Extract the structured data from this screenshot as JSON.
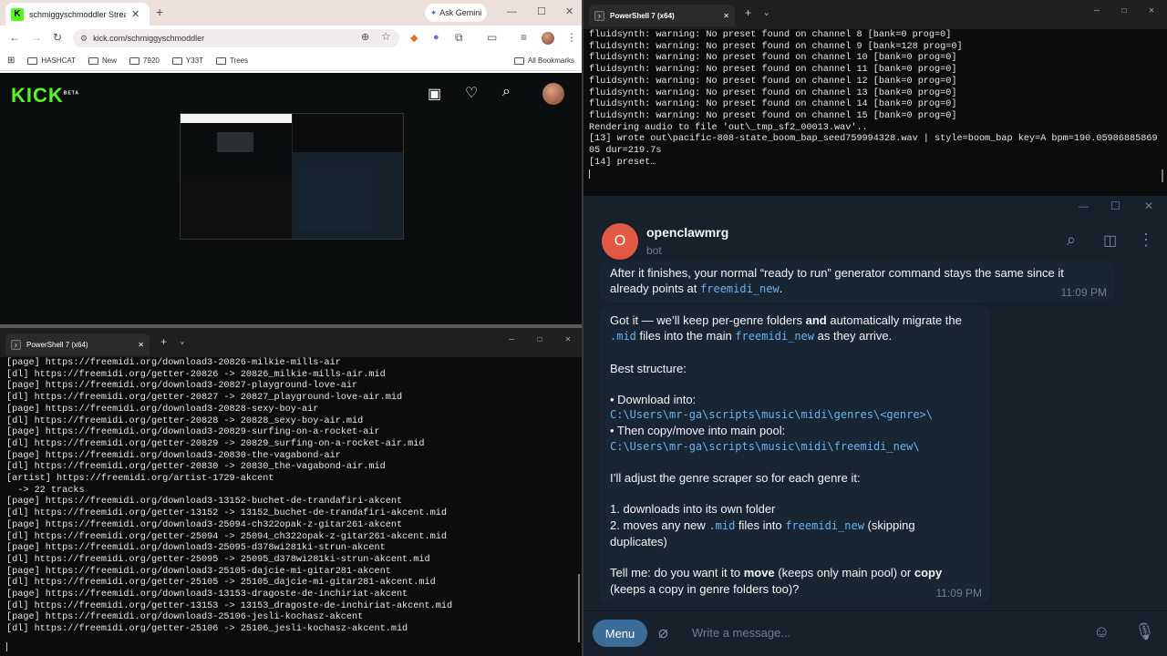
{
  "browser": {
    "tab_title": "schmiggyschmoddler Stream -",
    "gemini_label": "Ask Gemini",
    "url": "kick.com/schmiggyschmoddler",
    "bookmarks": [
      "HASHCAT",
      "New",
      "7920",
      "Y33T",
      "Trees"
    ],
    "all_bookmarks": "All Bookmarks",
    "kick_logo": "KICK",
    "kick_beta": "BETA"
  },
  "term_top": {
    "tab_title": "PowerShell 7 (x64)",
    "lines": [
      "fluidsynth: warning: No preset found on channel 8 [bank=0 prog=0]",
      "fluidsynth: warning: No preset found on channel 9 [bank=128 prog=0]",
      "fluidsynth: warning: No preset found on channel 10 [bank=0 prog=0]",
      "fluidsynth: warning: No preset found on channel 11 [bank=0 prog=0]",
      "fluidsynth: warning: No preset found on channel 12 [bank=0 prog=0]",
      "fluidsynth: warning: No preset found on channel 13 [bank=0 prog=0]",
      "fluidsynth: warning: No preset found on channel 14 [bank=0 prog=0]",
      "fluidsynth: warning: No preset found on channel 15 [bank=0 prog=0]",
      "Rendering audio to file 'out\\_tmp_sf2_00013.wav'..",
      "[13] wrote out\\pacific-808-state_boom_bap_seed759994328.wav | style=boom_bap key=A bpm=190.05986885869",
      "05 dur=219.7s",
      "[14] preset…"
    ]
  },
  "term_bottom": {
    "tab_title": "PowerShell 7 (x64)",
    "lines": [
      "[page] https://freemidi.org/download3-20826-milkie-mills-air",
      "[dl] https://freemidi.org/getter-20826 -> 20826_milkie-mills-air.mid",
      "[page] https://freemidi.org/download3-20827-playground-love-air",
      "[dl] https://freemidi.org/getter-20827 -> 20827_playground-love-air.mid",
      "[page] https://freemidi.org/download3-20828-sexy-boy-air",
      "[dl] https://freemidi.org/getter-20828 -> 20828_sexy-boy-air.mid",
      "[page] https://freemidi.org/download3-20829-surfing-on-a-rocket-air",
      "[dl] https://freemidi.org/getter-20829 -> 20829_surfing-on-a-rocket-air.mid",
      "[page] https://freemidi.org/download3-20830-the-vagabond-air",
      "[dl] https://freemidi.org/getter-20830 -> 20830_the-vagabond-air.mid",
      "[artist] https://freemidi.org/artist-1729-akcent",
      "  -> 22 tracks",
      "[page] https://freemidi.org/download3-13152-buchet-de-trandafiri-akcent",
      "[dl] https://freemidi.org/getter-13152 -> 13152_buchet-de-trandafiri-akcent.mid",
      "[page] https://freemidi.org/download3-25094-ch322opak-z-gitar261-akcent",
      "[dl] https://freemidi.org/getter-25094 -> 25094_ch322opak-z-gitar261-akcent.mid",
      "[page] https://freemidi.org/download3-25095-d378wi281ki-strun-akcent",
      "[dl] https://freemidi.org/getter-25095 -> 25095_d378wi281ki-strun-akcent.mid",
      "[page] https://freemidi.org/download3-25105-dajcie-mi-gitar281-akcent",
      "[dl] https://freemidi.org/getter-25105 -> 25105_dajcie-mi-gitar281-akcent.mid",
      "[page] https://freemidi.org/download3-13153-dragoste-de-inchiriat-akcent",
      "[dl] https://freemidi.org/getter-13153 -> 13153_dragoste-de-inchiriat-akcent.mid",
      "[page] https://freemidi.org/download3-25106-jesli-kochasz-akcent",
      "[dl] https://freemidi.org/getter-25106 -> 25106_jesli-kochasz-akcent.mid"
    ]
  },
  "telegram": {
    "avatar_letter": "O",
    "chat_name": "openclawmrg",
    "chat_status": "bot",
    "msg1": {
      "text": "After it finishes, your normal “ready to run” generator command stays the same since it already points at ",
      "code": "freemidi_new",
      "end": ".",
      "time": "11:09 PM"
    },
    "msg2": {
      "p1_a": "Got it — we’ll keep per-genre folders ",
      "p1_b": "and",
      "p1_c": " automatically migrate the",
      "p1_code1": ".mid",
      "p1_d": " files into the main ",
      "p1_code2": "freemidi_new",
      "p1_e": " as they arrive.",
      "best": "Best structure:",
      "b1": "• Download into:",
      "b1_path": "C:\\Users\\mr-ga\\scripts\\music\\midi\\genres\\<genre>\\",
      "b2": "• Then copy/move into main pool:",
      "b2_path": "C:\\Users\\mr-ga\\scripts\\music\\midi\\freemidi_new\\",
      "adjust": "I’ll adjust the genre scraper so for each genre it:",
      "s1": "1. downloads into its own folder",
      "s2_a": "2. moves any new ",
      "s2_code1": ".mid",
      "s2_b": " files into ",
      "s2_code2": "freemidi_new",
      "s2_c": " (skipping",
      "s2_d": "duplicates)",
      "q_a": "Tell me: do you want it to ",
      "q_b": "move",
      "q_c": " (keeps only main pool) or ",
      "q_d": "copy",
      "q_e": "(keeps a copy in genre folders too)?",
      "time": "11:09 PM"
    },
    "menu_label": "Menu",
    "input_placeholder": "Write a message..."
  }
}
